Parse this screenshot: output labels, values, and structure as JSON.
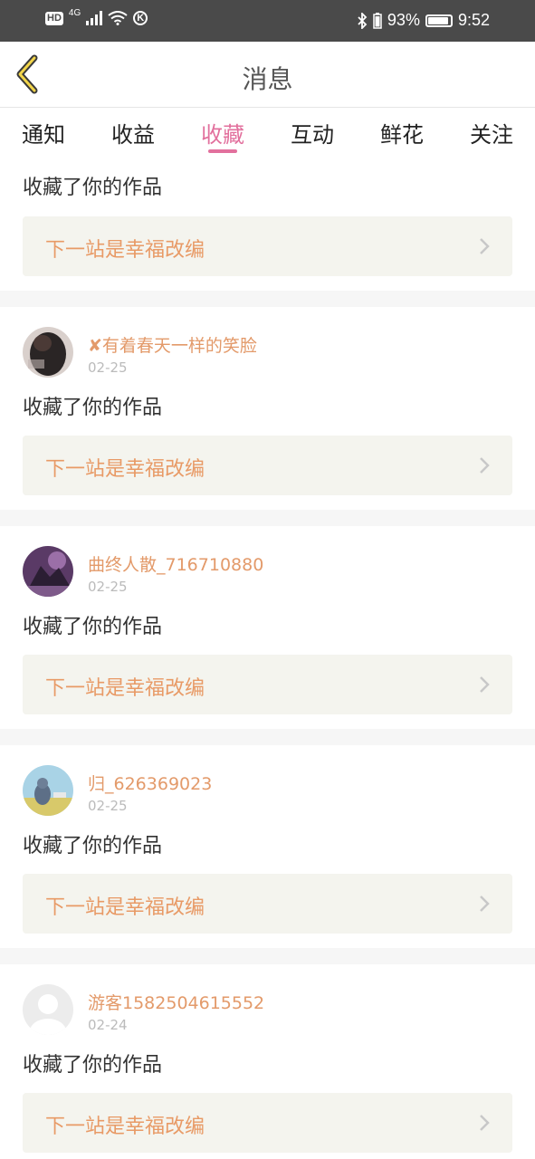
{
  "status_bar": {
    "hd": "HD",
    "network": "4G",
    "k": "K",
    "battery_pct": "93%",
    "battery_level": 0.93,
    "time": "9:52"
  },
  "header": {
    "title": "消息"
  },
  "tabs": [
    {
      "label": "通知"
    },
    {
      "label": "收益"
    },
    {
      "label": "收藏",
      "active": true
    },
    {
      "label": "互动"
    },
    {
      "label": "鲜花"
    },
    {
      "label": "关注"
    }
  ],
  "items": [
    {
      "action": "收藏了你的作品",
      "work": "下一站是幸福改编"
    },
    {
      "username": "✘有着春天一样的笑脸",
      "date": "02-25",
      "avatar": "dark-avatar",
      "action": "收藏了你的作品",
      "work": "下一站是幸福改编"
    },
    {
      "username": "曲终人散_716710880",
      "date": "02-25",
      "avatar": "purple-avatar",
      "action": "收藏了你的作品",
      "work": "下一站是幸福改编"
    },
    {
      "username": "归_626369023",
      "date": "02-25",
      "avatar": "cartoon-avatar",
      "action": "收藏了你的作品",
      "work": "下一站是幸福改编"
    },
    {
      "username": "游客1582504615552",
      "date": "02-24",
      "avatar": "default-avatar",
      "action": "收藏了你的作品",
      "work": "下一站是幸福改编"
    }
  ],
  "colors": {
    "accent": "#e2709d",
    "username": "#e39a6a",
    "work_title": "#e89a66",
    "card_bg": "#f4f4ee"
  }
}
